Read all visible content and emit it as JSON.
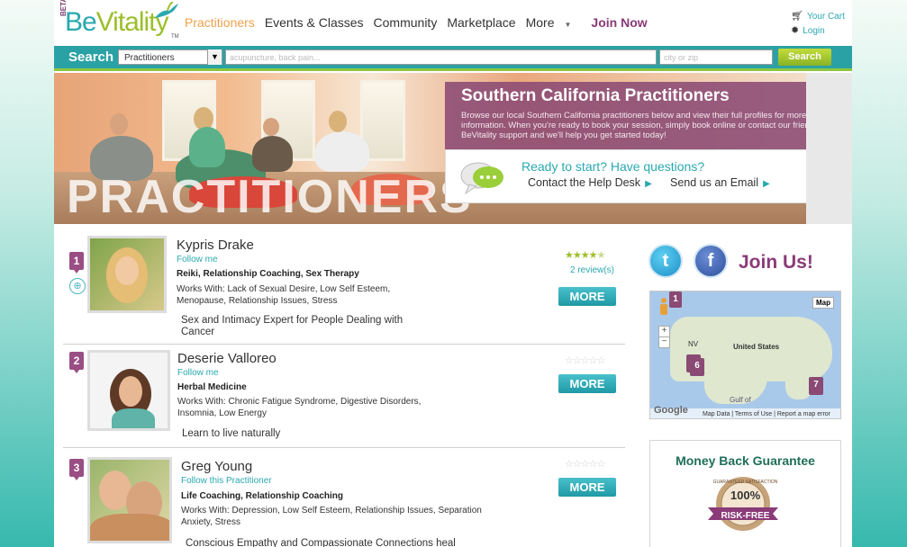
{
  "header": {
    "logo_beta": "BETA",
    "logo_name_a": "Be",
    "logo_name_b": "Vitality",
    "logo_tm": "TM",
    "nav": [
      "Practitioners",
      "Events & Classes",
      "Community",
      "Marketplace",
      "More"
    ],
    "join_now": "Join Now",
    "cart": "Your Cart",
    "login": "Login"
  },
  "search": {
    "label": "Search",
    "category_value": "Practitioners",
    "keyword_placeholder": "acupuncture, back pain...",
    "location_placeholder": "city or zip",
    "button": "Search"
  },
  "hero": {
    "big_word": "PRACTITIONERS",
    "title": "Southern California Practitioners",
    "description": "Browse our local Southern California practitioners below and view their full profiles for more information. When you're ready to book your session, simply book online or contact our friendly BeVitality support and we'll help you get started today!",
    "question": "Ready to start? Have questions?",
    "help_desk": "Contact the Help Desk",
    "email": "Send us an Email"
  },
  "practitioners": [
    {
      "rank": "1",
      "name": "Kypris Drake",
      "follow": "Follow me",
      "specialties": "Reiki, Relationship Coaching, Sex Therapy",
      "works_with": "Works With: Lack of Sexual Desire, Low Self Esteem, Menopause, Relationship Issues, Stress",
      "tagline": "Sex and Intimacy Expert for People Dealing with Cancer",
      "rating": 4.5,
      "reviews": "2 review(s)",
      "more": "MORE"
    },
    {
      "rank": "2",
      "name": "Deserie Valloreo",
      "follow": "Follow me",
      "specialties": "Herbal Medicine",
      "works_with": "Works With: Chronic Fatigue Syndrome, Digestive Disorders, Insomnia, Low Energy",
      "tagline": "Learn to live naturally",
      "rating": 0,
      "reviews": "",
      "more": "MORE"
    },
    {
      "rank": "3",
      "name": "Greg Young",
      "follow": "Follow this Practitioner",
      "specialties": "Life Coaching, Relationship Coaching",
      "works_with": "Works With: Depression, Low Self Esteem, Relationship Issues, Separation Anxiety, Stress",
      "tagline": "Conscious Empathy and Compassionate Connections heal",
      "rating": 0,
      "reviews": "",
      "more": "MORE"
    }
  ],
  "sidebar": {
    "twitter_glyph": "t",
    "facebook_glyph": "f",
    "join_us": "Join Us!",
    "map": {
      "map_button": "Map",
      "zoom_in": "+",
      "zoom_out": "−",
      "country_label": "United States",
      "nv_label": "NV",
      "gulf_label": "Gulf of",
      "google": "Google",
      "footer": "Map Data | Terms of Use | Report a map error",
      "pins": [
        "1",
        "6",
        "7"
      ]
    },
    "guarantee_title": "Money Back Guarantee",
    "seal_percent": "100%",
    "seal_text": "RISK-FREE",
    "seal_arc": "GUARANTEED SATISFACTION"
  },
  "colors": {
    "brand_teal": "#2aa8b0",
    "brand_purple": "#8a3b78",
    "accent_green": "#8dc63f",
    "nav_active": "#f0a04b"
  }
}
